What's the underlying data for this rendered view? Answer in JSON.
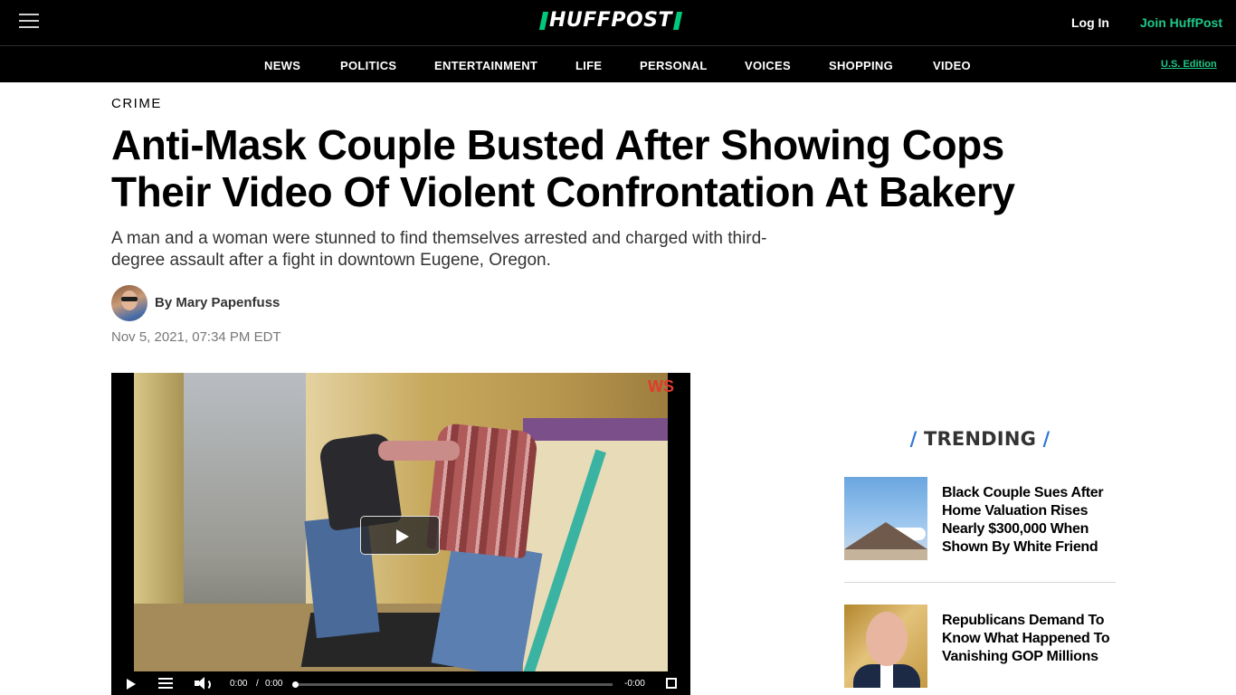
{
  "header": {
    "logo_text": "HUFFPOST",
    "login_label": "Log In",
    "join_label": "Join HuffPost",
    "brand_color": "#00c97b"
  },
  "nav": {
    "items": [
      "NEWS",
      "POLITICS",
      "ENTERTAINMENT",
      "LIFE",
      "PERSONAL",
      "VOICES",
      "SHOPPING",
      "VIDEO"
    ],
    "edition_label": "U.S. Edition"
  },
  "article": {
    "section": "CRIME",
    "headline": "Anti-Mask Couple Busted After Showing Cops Their Video Of Violent Confrontation At Bakery",
    "dek": "A man and a woman were stunned to find themselves arrested and charged with third-degree assault after a fight in downtown Eugene, Oregon.",
    "byline_prefix": "By",
    "author": "Mary Papenfuss",
    "timestamp": "Nov 5, 2021, 07:34 PM EDT"
  },
  "video": {
    "watermark": "WS",
    "current_time": "0:00",
    "separator": "/",
    "duration": "0:00",
    "remaining": "-0:00"
  },
  "trending": {
    "title": "TRENDING",
    "slash": "/",
    "accent_color": "#2f78d6",
    "items": [
      {
        "title": "Black Couple Sues After Home Valuation Rises Nearly $300,000 When Shown By White Friend"
      },
      {
        "title": "Republicans Demand To Know What Happened To Vanishing GOP Millions"
      }
    ]
  }
}
